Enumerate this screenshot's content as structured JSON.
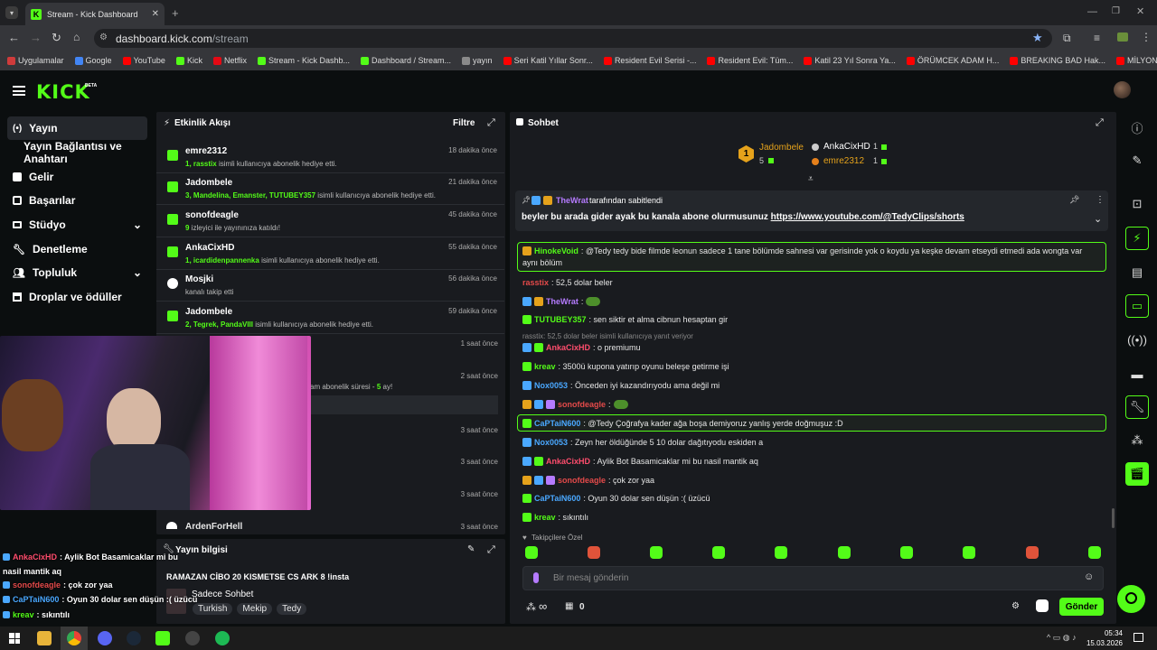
{
  "browser": {
    "tab_title": "Stream - Kick Dashboard",
    "url_host": "dashboard.kick.com",
    "url_path": "/stream",
    "bookmarks": [
      {
        "label": "Uygulamalar",
        "color": "#cf3b3b"
      },
      {
        "label": "Google",
        "color": "#4285f4"
      },
      {
        "label": "YouTube",
        "color": "#ff0000"
      },
      {
        "label": "Kick",
        "color": "#53fc18"
      },
      {
        "label": "Netflix",
        "color": "#e50914"
      },
      {
        "label": "Stream - Kick Dashb...",
        "color": "#53fc18"
      },
      {
        "label": "Dashboard / Stream...",
        "color": "#53fc18"
      },
      {
        "label": "yayın",
        "color": "#8a8a8a"
      },
      {
        "label": "Seri Katil Yıllar Sonr...",
        "color": "#ff0000"
      },
      {
        "label": "Resident Evil Serisi -...",
        "color": "#ff0000"
      },
      {
        "label": "Resident Evil: Tüm...",
        "color": "#ff0000"
      },
      {
        "label": "Katil 23 Yıl Sonra Ya...",
        "color": "#ff0000"
      },
      {
        "label": "ÖRÜMCEK ADAM H...",
        "color": "#ff0000"
      },
      {
        "label": "BREAKING BAD Hak...",
        "color": "#ff0000"
      },
      {
        "label": "MİLYONLAR ÇALAR...",
        "color": "#ff0000"
      }
    ]
  },
  "brand": {
    "logo": "KICK",
    "beta": "BETA",
    "accent": "#53fc18"
  },
  "sidebar": {
    "items": [
      {
        "label": "Yayın",
        "icon": "broadcast-icon"
      },
      {
        "label": "Yayın Bağlantısı ve Anahtarı"
      },
      {
        "label": "Gelir",
        "icon": "revenue-icon"
      },
      {
        "label": "Başarılar",
        "icon": "trophy-icon"
      },
      {
        "label": "Stüdyo",
        "icon": "studio-icon"
      },
      {
        "label": "Denetleme",
        "icon": "wrench-icon"
      },
      {
        "label": "Topluluk",
        "icon": "people-icon"
      },
      {
        "label": "Droplar ve ödüller",
        "icon": "gift-icon"
      }
    ]
  },
  "activity": {
    "title": "Etkinlik Akışı",
    "filter": "Filtre",
    "items": [
      {
        "name": "emre2312",
        "num": "1,",
        "who": "rasstix",
        "text": "isimli kullanıcıya abonelik hediye etti.",
        "time": "18 dakika önce"
      },
      {
        "name": "Jadombele",
        "num": "3,",
        "who": "Mandelina, Emanster, TUTUBEY357",
        "text": "isimli kullanıcıya abonelik hediye etti.",
        "time": "21 dakika önce"
      },
      {
        "name": "sonofdeagle",
        "num": "9",
        "who": "",
        "text": "izleyici ile yayınınıza katıldı!",
        "time": "45 dakika önce"
      },
      {
        "name": "AnkaCixHD",
        "num": "1,",
        "who": "icardidenpannenka",
        "text": "isimli kullanıcıya abonelik hediye etti.",
        "time": "55 dakika önce"
      },
      {
        "name": "Mosjki",
        "num": "",
        "who": "",
        "text": "kanalı takip etti",
        "time": "56 dakika önce"
      },
      {
        "name": "Jadombele",
        "num": "2,",
        "who": "Tegrek, PandaVIII",
        "text": "isimli kullanıcıya abonelik hediye etti.",
        "time": "59 dakika önce"
      }
    ],
    "more_times": [
      "1 saat önce",
      "2 saat önce",
      "3 saat önce",
      "3 saat önce",
      "3 saat önce",
      "3 saat önce"
    ],
    "partial_text": "am abonelik süresi - ",
    "partial_num": "5",
    "partial_suffix": " ay!",
    "last_name": "ArdenForHell"
  },
  "stream_info": {
    "title": "Yayın bilgisi",
    "stream_title": "RAMAZAN CİBO 20 KISMETSE CS ARK 8 !insta",
    "category": "Sadece Sohbet",
    "tags": [
      "Turkish",
      "Mekip",
      "Tedy"
    ]
  },
  "chat": {
    "title": "Sohbet",
    "leaderboard": {
      "first": {
        "name": "Jadombele",
        "rank": "1",
        "count": "5"
      },
      "second": {
        "name": "AnkaCixHD",
        "count": "1"
      },
      "third": {
        "name": "emre2312",
        "count": "1"
      }
    },
    "pinned": {
      "user": "TheWrat",
      "by": "tarafından sabitlendi",
      "text": "beyler bu arada gider ayak bu kanala abone olurmusunuz ",
      "link": "https://www.youtube.com/@TedyClips/shorts"
    },
    "messages": [
      {
        "user": "HinokeVoid",
        "color": "#53fc18",
        "text": ": @Tedy tedy bide filmde leonun sadece 1 tane bölümde sahnesi var gerisinde yok o koydu ya keşke devam etseydi etmedi ada wongta var",
        "text2": "aynı bölüm",
        "highlight": true
      },
      {
        "user": "rasstix",
        "color": "#e44a4a",
        "text": ": 52,5 dolar beler"
      },
      {
        "user": "TheWrat",
        "color": "#b57bff",
        "text": ":"
      },
      {
        "user": "TUTUBEY357",
        "color": "#53fc18",
        "text": ": sen siktir et alma cibnun hesaptan gir"
      },
      {
        "reply": "rasstix: 52,5 dolar beler isimli kullanıcıya yanıt veriyor",
        "user": "AnkaCixHD",
        "color": "#ff4d6d",
        "text": ": o premiumu"
      },
      {
        "user": "kreav",
        "color": "#53fc18",
        "text": ": 3500ü kupona yatırıp oyunu beleşe getirme işi"
      },
      {
        "user": "Nox0053",
        "color": "#4aa8ff",
        "text": ": Önceden iyi kazandırıyodu ama değil mi"
      },
      {
        "user": "sonofdeagle",
        "color": "#e44a4a",
        "text": ":"
      },
      {
        "user": "CaPTaiN600",
        "color": "#4aa8ff",
        "text": ": @Tedy Çoğrafya kader ağa boşa demiyoruz yanlış yerde doğmuşuz :D",
        "highlight": true
      },
      {
        "user": "Nox0053",
        "color": "#4aa8ff",
        "text": ": Zeyn her öldüğünde 5 10 dolar dağıtıyodu eskiden a"
      },
      {
        "user": "AnkaCixHD",
        "color": "#ff4d6d",
        "text": ": Aylik Bot Basamicaklar mi bu nasil mantik aq"
      },
      {
        "user": "sonofdeagle",
        "color": "#e44a4a",
        "text": ": çok zor yaa"
      },
      {
        "user": "CaPTaiN600",
        "color": "#4aa8ff",
        "text": ": Oyun 30 dolar sen düşün :( üzücü"
      },
      {
        "user": "kreav",
        "color": "#53fc18",
        "text": ": sıkıntılı"
      }
    ],
    "followers_label": "Takipçilere Özel",
    "input_placeholder": "Bir mesaj gönderin",
    "send": "Gönder",
    "infinity": "∞",
    "points": "0"
  },
  "overlay_chat": [
    {
      "user": "AnkaCixHD",
      "color": "#ff4d6d",
      "text": ": Aylik Bot Basamicaklar mi bu"
    },
    {
      "user": "",
      "color": "#fff",
      "text": "nasil mantik aq"
    },
    {
      "user": "sonofdeagle",
      "color": "#e44a4a",
      "text": ": çok zor yaa"
    },
    {
      "user": "CaPTaiN600",
      "color": "#4aa8ff",
      "text": ": Oyun 30 dolar sen düşün :( üzücü"
    },
    {
      "user": "kreav",
      "color": "#53fc18",
      "text": ": sıkıntılı"
    }
  ],
  "taskbar": {
    "time": "05:34",
    "date": "15.03.2026"
  }
}
